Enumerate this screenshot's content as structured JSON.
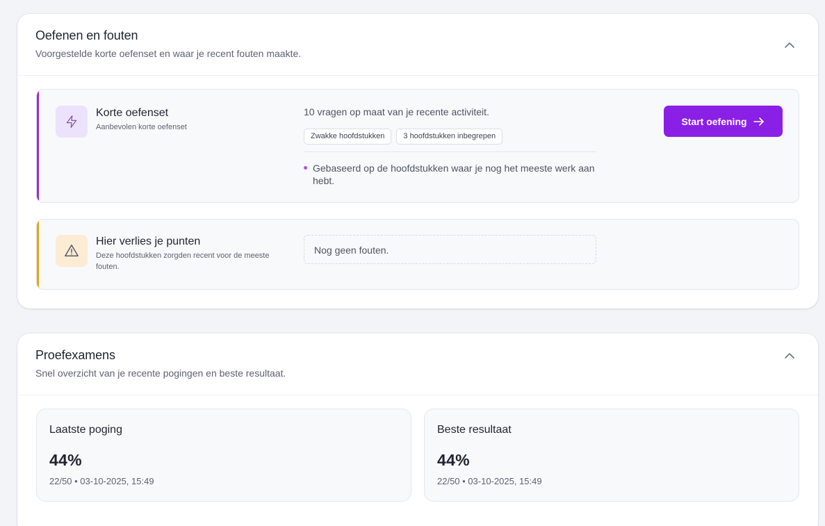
{
  "practice_section": {
    "title": "Oefenen en fouten",
    "subtitle": "Voorgestelde korte oefenset en waar je recent fouten maakte.",
    "quiz_panel": {
      "title": "Korte oefenset",
      "subtitle": "Aanbevolen korte oefenset",
      "description": "10 vragen op maat van je recente activiteit.",
      "tags": [
        "Zwakke hoofdstukken",
        "3 hoofdstukken inbegrepen"
      ],
      "bullet": "Gebaseerd op de hoofdstukken waar je nog het meeste werk aan hebt.",
      "button_label": "Start oefening",
      "accent_color": "#9b2bd8",
      "icon": "lightning-icon"
    },
    "loss_panel": {
      "title": "Hier verlies je punten",
      "subtitle": "Deze hoofdstukken zorgden recent voor de meeste fouten.",
      "empty_text": "Nog geen fouten.",
      "accent_color": "#e3a414",
      "icon": "warning-triangle-icon"
    }
  },
  "exams_section": {
    "title": "Proefexamens",
    "subtitle": "Snel overzicht van je recente pogingen en beste resultaat.",
    "latest": {
      "label": "Laatste poging",
      "value": "44%",
      "meta": "22/50 • 03-10-2025, 15:49"
    },
    "best": {
      "label": "Beste resultaat",
      "value": "44%",
      "meta": "22/50 • 03-10-2025, 15:49"
    }
  },
  "colors": {
    "primary": "#8a1fe6",
    "background": "#f2f4f8"
  }
}
